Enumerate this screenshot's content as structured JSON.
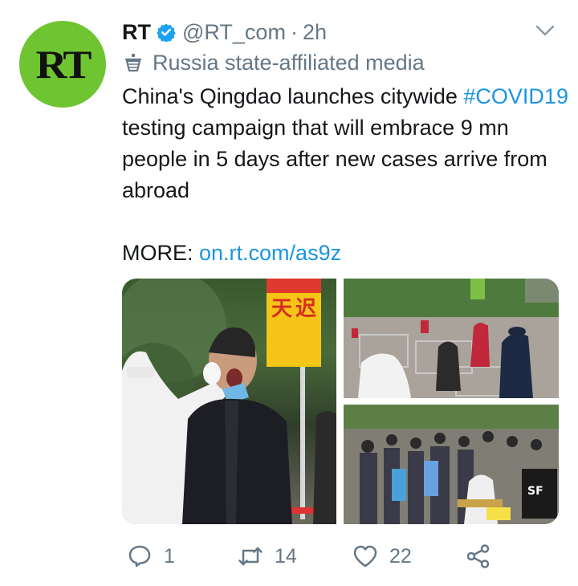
{
  "tweet": {
    "avatar_text": "RT",
    "name": "RT",
    "handle": "@RT_com",
    "separator": "·",
    "time": "2h",
    "label": "Russia state-affiliated media",
    "text_part1": "China's Qingdao launches citywide ",
    "hashtag": "#COVID19",
    "text_part2": " testing campaign that will embrace 9 mn people in 5 days after new cases arrive from abroad",
    "more_prefix": "MORE: ",
    "link": "on.rt.com/as9z"
  },
  "media": {
    "main_sign_chars": [
      "天",
      "迟"
    ],
    "badge_text": "SF"
  },
  "actions": {
    "reply_count": "1",
    "retweet_count": "14",
    "like_count": "22"
  },
  "colors": {
    "accent": "#1b95e0",
    "avatar_bg": "#6ec531",
    "muted": "#657786"
  }
}
